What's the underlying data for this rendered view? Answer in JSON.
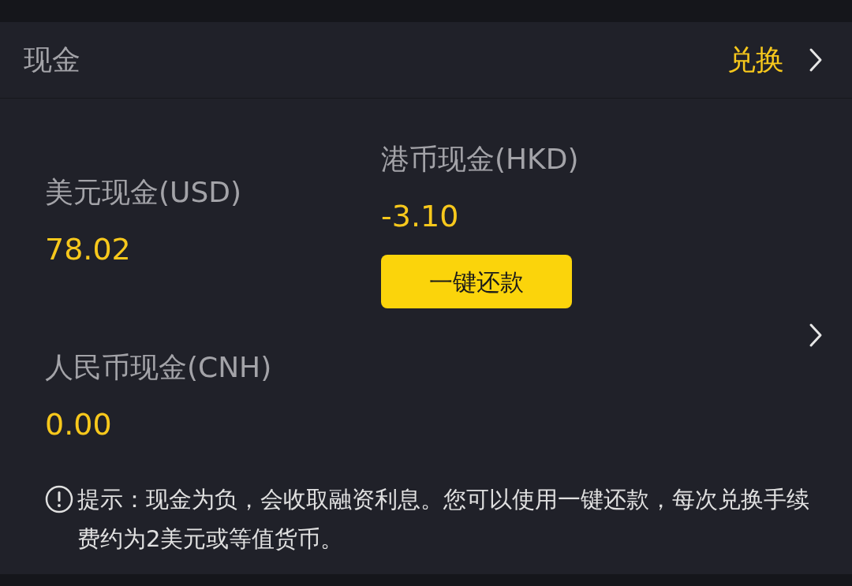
{
  "header": {
    "title": "现金",
    "action": "兑换"
  },
  "columns": [
    [
      {
        "label": "美元现金(USD)",
        "value": "78.02"
      },
      {
        "label": "人民币现金(CNH)",
        "value": "0.00"
      }
    ],
    [
      {
        "label": "港币现金(HKD)",
        "value": "-3.10",
        "button": "一键还款"
      }
    ]
  ],
  "note": {
    "text": "提示：现金为负，会收取融资利息。您可以使用一键还款，每次兑换手续费约为2美元或等值货币。"
  }
}
